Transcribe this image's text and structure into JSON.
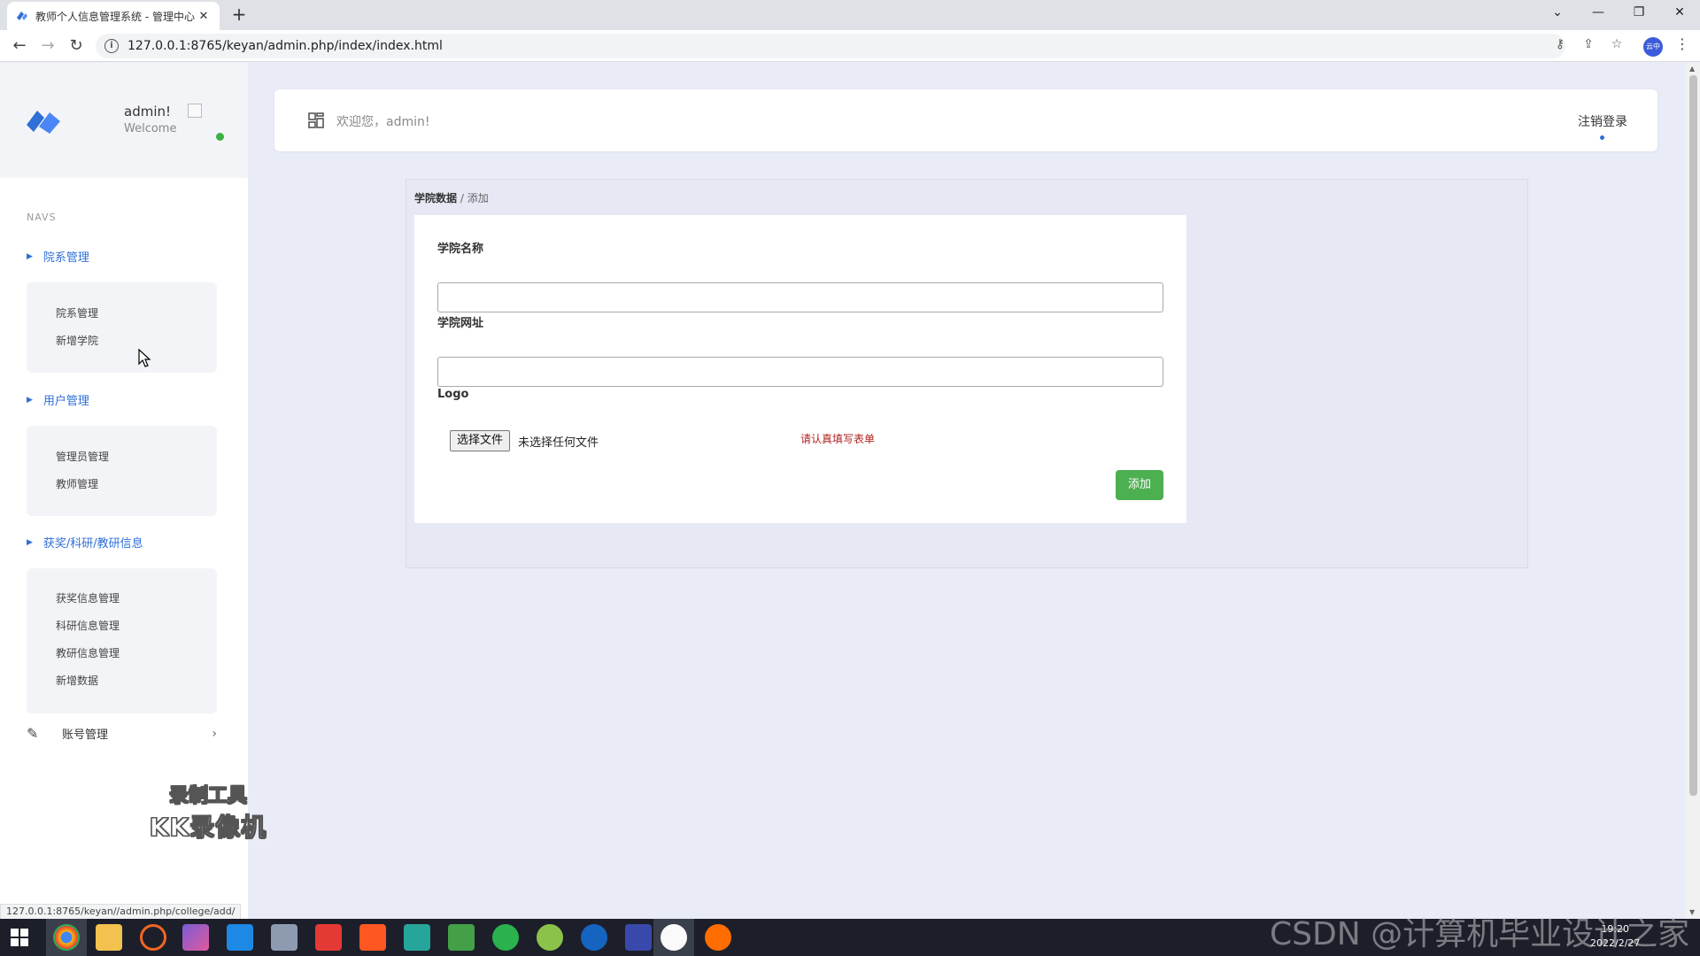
{
  "browser": {
    "tab_title": "教师个人信息管理系统 - 管理中心",
    "tab_close": "✕",
    "new_tab": "+",
    "url": "127.0.0.1:8765/keyan/admin.php/index/index.html",
    "status_url": "127.0.0.1:8765/keyan//admin.php/college/add/",
    "profile_label": "云中"
  },
  "sidebar": {
    "user": "admin!",
    "welcome": "Welcome",
    "navs_title": "NAVS",
    "groups": [
      {
        "title": "院系管理",
        "items": [
          "院系管理",
          "新增学院"
        ]
      },
      {
        "title": "用户管理",
        "items": [
          "管理员管理",
          "教师管理"
        ]
      },
      {
        "title": "获奖/科研/教研信息",
        "items": [
          "获奖信息管理",
          "科研信息管理",
          "教研信息管理",
          "新增数据"
        ]
      }
    ],
    "account": "账号管理"
  },
  "topbar": {
    "welcome": "欢迎您，admin!",
    "logout": "注销登录"
  },
  "breadcrumb": {
    "main": "学院数据",
    "sep": " / ",
    "current": "添加"
  },
  "form": {
    "name_label": "学院名称",
    "name_value": "",
    "url_label": "学院网址",
    "url_value": "",
    "logo_label": "Logo",
    "file_button": "选择文件",
    "file_status": "未选择任何文件",
    "warning": "请认真填写表单",
    "submit": "添加"
  },
  "watermark": {
    "line1": "录制工具",
    "line2": "KK录像机"
  },
  "taskbar": {
    "time": "19:20",
    "date": "2022/2/27"
  },
  "overlay": {
    "csdn": "CSDN @计算机毕业设计之家"
  },
  "colors": {
    "accent": "#2f6fd6",
    "success": "#4caf50",
    "warning": "#b0221f",
    "online": "#3cb043"
  }
}
